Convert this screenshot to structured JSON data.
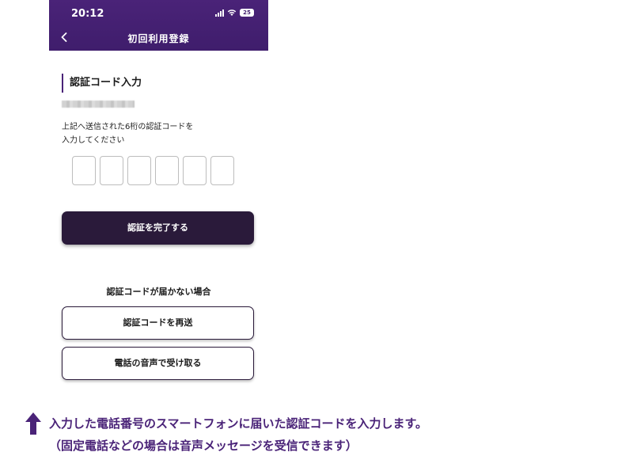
{
  "status_bar": {
    "time": "20:12",
    "battery": "25"
  },
  "header": {
    "title": "初回利用登録"
  },
  "form": {
    "section_title": "認証コード入力",
    "instruction_line1": "上記へ送信された6桁の認証コードを",
    "instruction_line2": "入力してください",
    "code_length": 6,
    "submit_label": "認証を完了する"
  },
  "fallback": {
    "heading": "認証コードが届かない場合",
    "resend_label": "認証コードを再送",
    "voice_label": "電話の音声で受け取る"
  },
  "annotation": {
    "line1": "入力した電話番号のスマートフォンに届いた認証コードを入力します。",
    "line2": "（固定電話などの場合は音声メッセージを受信できます）",
    "accent_color": "#4a2378"
  }
}
